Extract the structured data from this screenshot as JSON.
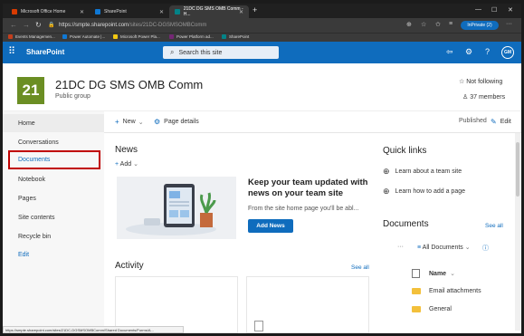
{
  "browser": {
    "tabs": [
      {
        "title": "Microsoft Office Home",
        "favicon_color": "#d83b01"
      },
      {
        "title": "SharePoint",
        "favicon_color": "#0f78d4"
      },
      {
        "title": "21DC DG SMS OMB Comm - H...",
        "favicon_color": "#038387"
      }
    ],
    "new_tab": "+",
    "url_host": "https://smpte.sharepoint.com",
    "url_path": "/sites/21DC-DGSMSOMBComm",
    "inprivate_label": "InPrivate (2)",
    "favorites": [
      {
        "label": "Events Managemen...",
        "icon_color": "#c43e1c"
      },
      {
        "label": "Power Automate |...",
        "icon_color": "#0f78d4"
      },
      {
        "label": "Microsoft Power Pla...",
        "icon_color": "#f2c811"
      },
      {
        "label": "Power Platform ad...",
        "icon_color": "#742774"
      },
      {
        "label": "SharePoint",
        "icon_color": "#038387"
      }
    ]
  },
  "suite": {
    "app_name": "SharePoint",
    "search_placeholder": "Search this site",
    "avatar_initials": "GM",
    "accent": "#0f6cbd"
  },
  "site": {
    "logo_text": "21",
    "name": "21DC DG SMS OMB Comm",
    "type": "Public group",
    "follow_label": "Not following",
    "members_label": "37 members"
  },
  "leftnav": {
    "items": [
      {
        "label": "Home"
      },
      {
        "label": "Conversations"
      },
      {
        "label": "Documents"
      },
      {
        "label": "Notebook"
      },
      {
        "label": "Pages"
      },
      {
        "label": "Site contents"
      },
      {
        "label": "Recycle bin"
      },
      {
        "label": "Edit"
      }
    ]
  },
  "commandbar": {
    "new_label": "New",
    "page_details_label": "Page details",
    "published_label": "Published",
    "edit_label": "Edit"
  },
  "news": {
    "title": "News",
    "add_label": "Add",
    "heading": "Keep your team updated with news on your team site",
    "description": "From the site home page you'll be abl...",
    "button_label": "Add News"
  },
  "activity": {
    "title": "Activity",
    "see_all": "See all"
  },
  "quicklinks": {
    "title": "Quick links",
    "items": [
      {
        "label": "Learn about a team site"
      },
      {
        "label": "Learn how to add a page"
      }
    ]
  },
  "documents": {
    "title": "Documents",
    "see_all": "See all",
    "view_label": "All Documents",
    "column_name": "Name",
    "rows": [
      {
        "name": "Email attachments"
      },
      {
        "name": "General"
      }
    ]
  },
  "statusbar": {
    "text": "https://smpte.sharepoint.com/sites/21DC-DGSMSOMBComm/Shared Documents/Forms/A..."
  }
}
